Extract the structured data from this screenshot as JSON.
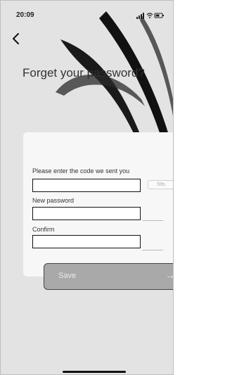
{
  "status_bar": {
    "time": "20:09",
    "icons": [
      "signal-icon",
      "wifi-icon",
      "battery-icon"
    ]
  },
  "header": {
    "back_icon": "chevron-left-icon",
    "title": "Forget your password?"
  },
  "form": {
    "code_label": "Please enter the code we sent you",
    "code_value": "",
    "countdown": "59s",
    "new_password_label": "New password",
    "new_password_value": "",
    "confirm_label": "Confirm",
    "confirm_value": ""
  },
  "actions": {
    "save_label": "Save",
    "arrow_icon": "arrow-right-icon",
    "arrow_glyph": "→"
  }
}
